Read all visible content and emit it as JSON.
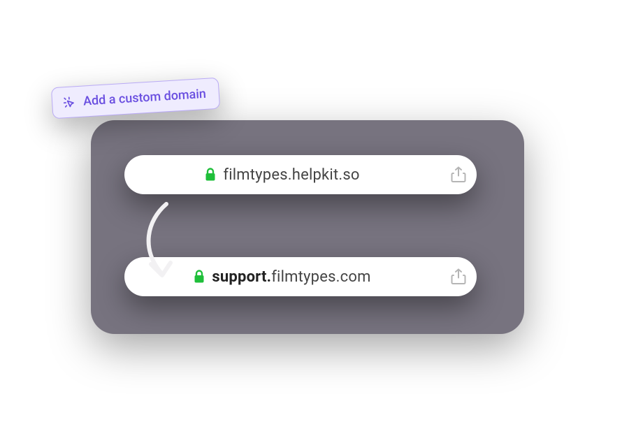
{
  "badge": {
    "label": "Add a custom domain"
  },
  "urls": {
    "first": {
      "full": "filmtypes.helpkit.so"
    },
    "second": {
      "bold": "support.",
      "rest": "filmtypes.com"
    }
  },
  "colors": {
    "panel": "#77737f",
    "badgeBg": "#efecfe",
    "badgeBorder": "#b9aaf5",
    "badgeText": "#6a4fe0",
    "lock": "#1fbf3a"
  }
}
